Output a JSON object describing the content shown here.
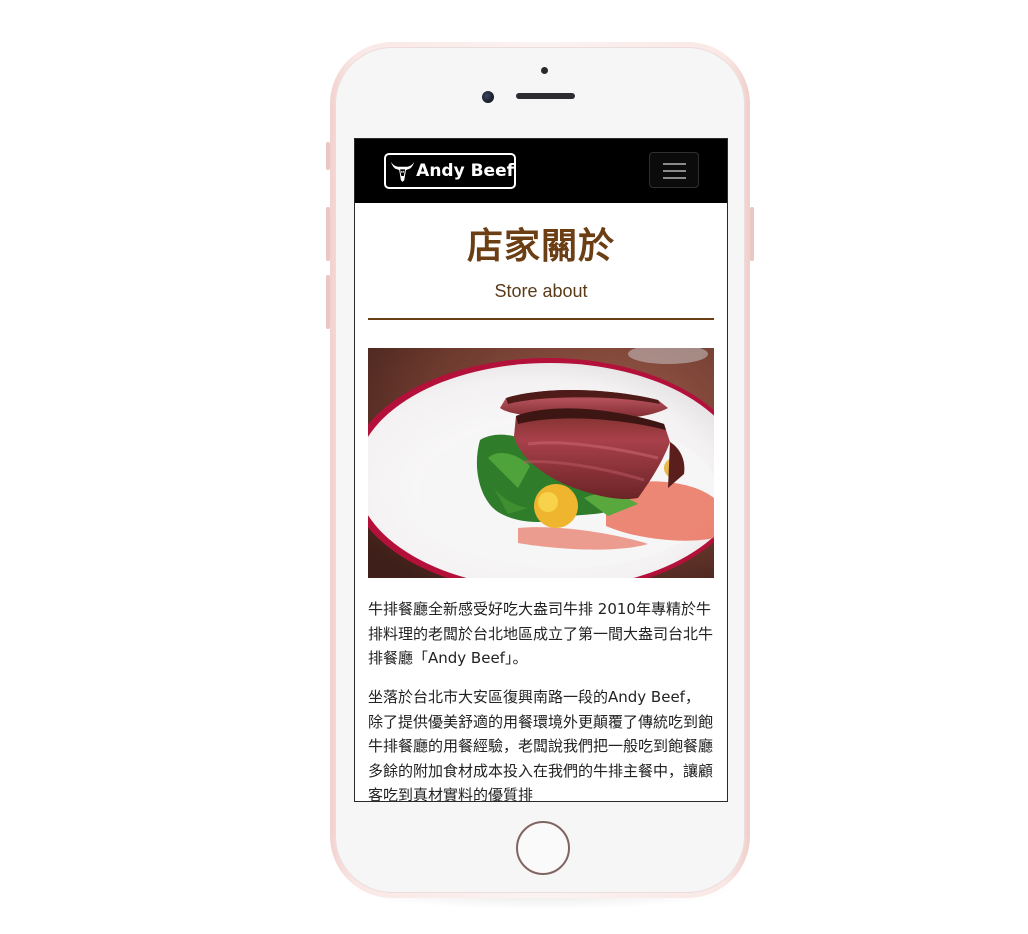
{
  "site": {
    "brand_name": "Andy Beef"
  },
  "navbar": {
    "toggle_icon": "hamburger-menu-icon"
  },
  "section": {
    "title": "店家關於",
    "subtitle": "Store about"
  },
  "hero_image": {
    "subject": "sliced steak on salad plate"
  },
  "content": {
    "paragraph_1": "牛排餐廳全新感受好吃大盎司牛排 2010年專精於牛排料理的老闆於台北地區成立了第一間大盎司台北牛排餐廳「Andy Beef」。",
    "paragraph_2": "坐落於台北市大安區復興南路一段的Andy Beef，除了提供優美舒適的用餐環境外更顛覆了傳統吃到飽牛排餐廳的用餐經驗，老闆說我們把一般吃到飽餐廳多餘的附加食材成本投入在我們的牛排主餐中，讓顧客吃到真材實料的優質排"
  },
  "colors": {
    "accent_brown": "#6b3e14",
    "navbar_bg": "#000000",
    "phone_frame": "#f4d8d5"
  }
}
